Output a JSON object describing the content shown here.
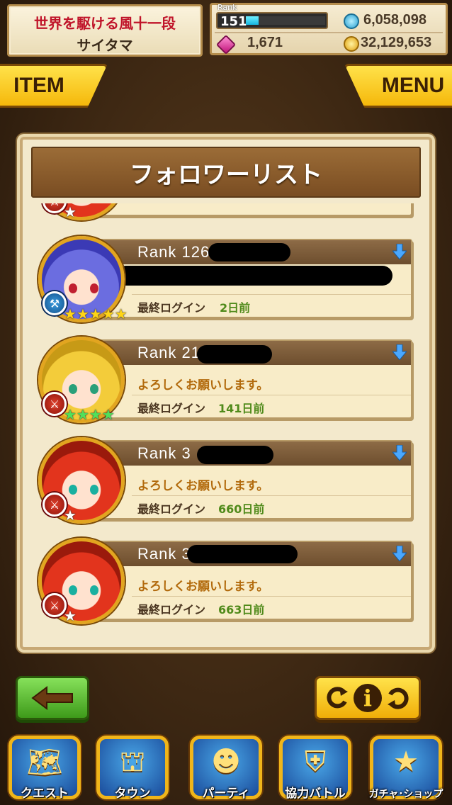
{
  "player": {
    "title": "世界を駆ける風十一段",
    "name": "サイタマ"
  },
  "stats": {
    "rank_label": "Rank",
    "rank": "151",
    "exp_progress": 0.16,
    "stamina": "6,058,098",
    "gems": "1,671",
    "coins": "32,129,653"
  },
  "buttons": {
    "item": "ITEM",
    "menu": "MENU",
    "info_glyph": "i"
  },
  "panel": {
    "title": "フォロワーリスト",
    "login_label": "最終ログイン"
  },
  "followers": [
    {
      "rank": "Rank   126",
      "message": "",
      "last_login": "2日前",
      "avatar": "blue-hair",
      "weapon": "axe-icon",
      "stars": 5,
      "star_color": "gold"
    },
    {
      "rank": "Rank   21",
      "message": "よろしくお願いします。",
      "last_login": "141日前",
      "avatar": "blonde-hair",
      "weapon": "sword-icon",
      "stars": 4,
      "star_color": "green"
    },
    {
      "rank": "Rank   3",
      "message": "よろしくお願いします。",
      "last_login": "660日前",
      "avatar": "red-hair",
      "weapon": "sword-icon",
      "stars": 1,
      "star_color": "white"
    },
    {
      "rank": "Rank   3",
      "message": "よろしくお願いします。",
      "last_login": "663日前",
      "avatar": "red-hair",
      "weapon": "sword-icon",
      "stars": 1,
      "star_color": "white"
    }
  ],
  "nav": [
    {
      "label": "クエスト",
      "icon": "quest-map-icon"
    },
    {
      "label": "タウン",
      "icon": "town-icon"
    },
    {
      "label": "パーティ",
      "icon": "party-icon"
    },
    {
      "label": "協力バトル",
      "icon": "coop-battle-icon"
    },
    {
      "label": "ガチャ･ショップ",
      "icon": "gacha-star-icon"
    }
  ],
  "colors": {
    "accent_gold": "#f5b80b",
    "login_green": "#4f8a1a",
    "message_orange": "#b26a0c",
    "panel_brown": "#7a4d22"
  }
}
